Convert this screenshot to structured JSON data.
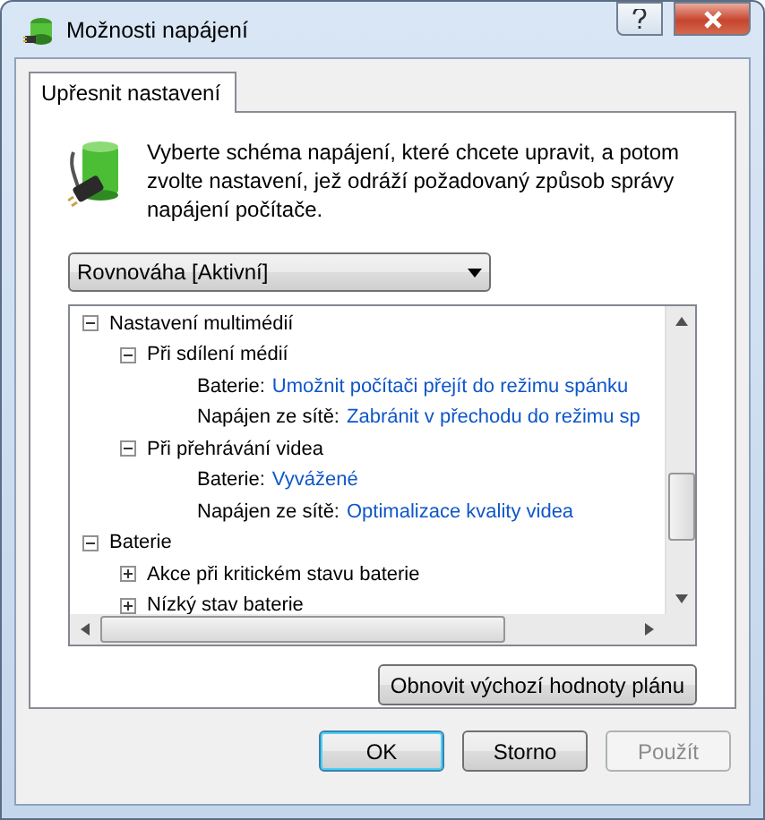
{
  "window": {
    "title": "Možnosti napájení"
  },
  "tabs": [
    {
      "label": "Upřesnit nastavení",
      "selected": true
    }
  ],
  "description": "Vyberte schéma napájení, které chcete upravit, a potom zvolte nastavení, jež odráží požadovaný způsob správy napájení počítače.",
  "plan_dropdown": {
    "value": "Rovnováha [Aktivní]"
  },
  "tree": [
    {
      "kind": "group",
      "label": "Nastavení multimédií",
      "expanded": true,
      "children": [
        {
          "kind": "group",
          "label": "Při sdílení médií",
          "expanded": true,
          "children": [
            {
              "kind": "setting",
              "label": "Baterie:",
              "value": "Umožnit počítači přejít do režimu spánku"
            },
            {
              "kind": "setting",
              "label": "Napájen ze sítě:",
              "value": "Zabránit v přechodu do režimu sp"
            }
          ]
        },
        {
          "kind": "group",
          "label": "Při přehrávání videa",
          "expanded": true,
          "children": [
            {
              "kind": "setting",
              "label": "Baterie:",
              "value": "Vyvážené"
            },
            {
              "kind": "setting",
              "label": "Napájen ze sítě:",
              "value": "Optimalizace kvality videa"
            }
          ]
        }
      ]
    },
    {
      "kind": "group",
      "label": "Baterie",
      "expanded": true,
      "children": [
        {
          "kind": "group",
          "label": "Akce při kritickém stavu baterie",
          "expanded": false
        },
        {
          "kind": "group",
          "label": "Nízký stav baterie",
          "expanded": false
        }
      ]
    }
  ],
  "restore_button": "Obnovit výchozí hodnoty plánu",
  "buttons": [
    {
      "label": "OK",
      "default": true,
      "disabled": false
    },
    {
      "label": "Storno",
      "default": false,
      "disabled": false
    },
    {
      "label": "Použít",
      "default": false,
      "disabled": true
    }
  ]
}
